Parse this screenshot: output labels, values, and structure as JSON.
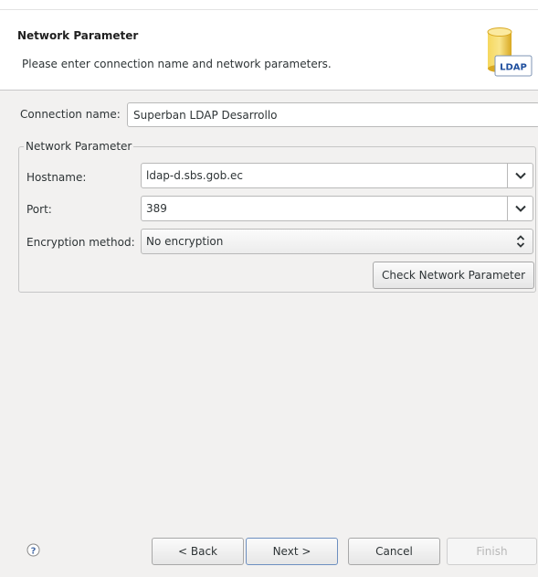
{
  "header": {
    "title": "Network Parameter",
    "description": "Please enter connection name and network parameters.",
    "icon": "ldap-database-icon",
    "icon_text": "LDAP"
  },
  "connection": {
    "label": "Connection name:",
    "value": "Superban LDAP Desarrollo"
  },
  "network_group": {
    "title": "Network Parameter",
    "hostname_label": "Hostname:",
    "hostname_value": "ldap-d.sbs.gob.ec",
    "port_label": "Port:",
    "port_value": "389",
    "encryption_label": "Encryption method:",
    "encryption_value": "No encryption",
    "check_button": "Check Network Parameter"
  },
  "footer": {
    "help_icon": "help-question-icon",
    "back": "< Back",
    "next": "Next >",
    "cancel": "Cancel",
    "finish": "Finish"
  },
  "colors": {
    "background": "#f2f1f0",
    "header_background": "#ffffff",
    "default_button_border": "#6d8fc0",
    "icon_gold": "#e8b92c",
    "icon_blue": "#1f4f9e"
  }
}
